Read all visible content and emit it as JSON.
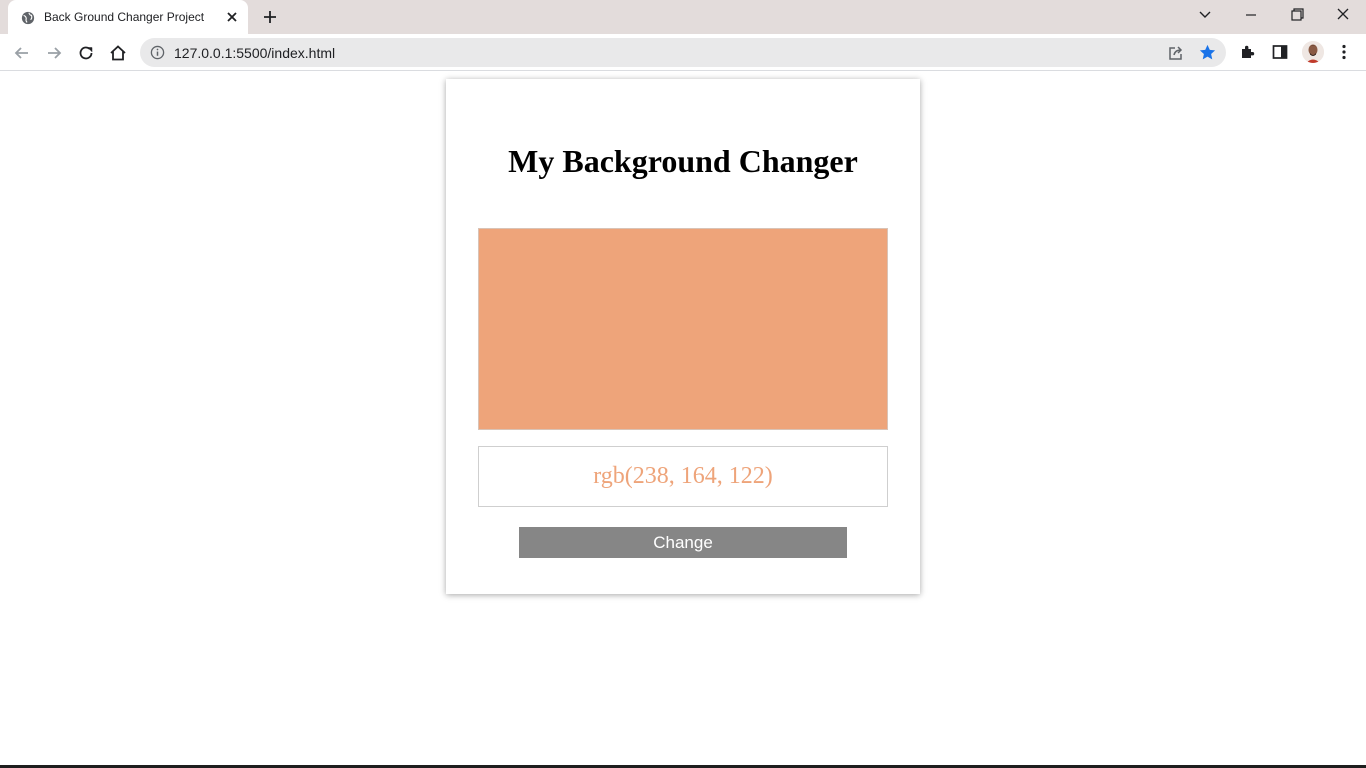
{
  "browser": {
    "tab": {
      "title": "Back Ground Changer Project",
      "favicon": "globe-icon"
    },
    "address_bar": {
      "url": "127.0.0.1:5500/index.html"
    },
    "bookmarked": true,
    "accent_color": "#1a73e8"
  },
  "page": {
    "title": "My Background Changer",
    "current_color": "rgb(238, 164, 122)",
    "swatch_color": "#eea47a",
    "button_label": "Change"
  }
}
